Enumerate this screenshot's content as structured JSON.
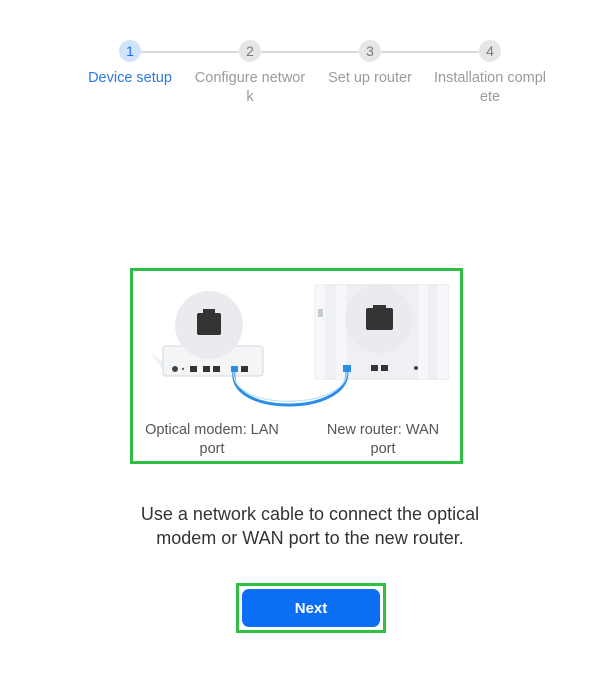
{
  "stepper": {
    "steps": [
      {
        "number": "1",
        "label": "Device setup",
        "active": true
      },
      {
        "number": "2",
        "label": "Configure network",
        "active": false
      },
      {
        "number": "3",
        "label": "Set up router",
        "active": false
      },
      {
        "number": "4",
        "label": "Installation complete",
        "active": false
      }
    ]
  },
  "illustration": {
    "modem_caption": "Optical modem: LAN port",
    "router_caption": "New router: WAN port",
    "cable_color": "#2b8de6"
  },
  "instruction": "Use a network cable to connect the optical modem or WAN port to the new router.",
  "next_button": {
    "label": "Next",
    "color": "#0a6ff5"
  },
  "colors": {
    "accent": "#1a73e8",
    "highlight_border": "#2fbf45"
  }
}
